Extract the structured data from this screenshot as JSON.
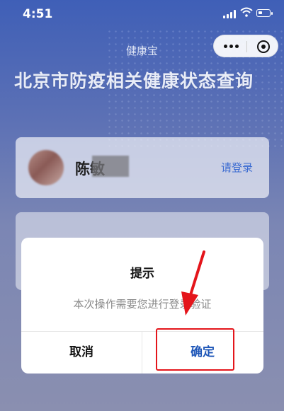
{
  "status_bar": {
    "time": "4:51"
  },
  "header": {
    "app_title": "健康宝"
  },
  "page": {
    "heading": "北京市防疫相关健康状态查询"
  },
  "user_card": {
    "name": "陈敏",
    "login_link": "请登录"
  },
  "dialog": {
    "title": "提示",
    "message": "本次操作需要您进行登录验证",
    "cancel_label": "取消",
    "confirm_label": "确定"
  },
  "colors": {
    "accent": "#1f57b8",
    "link": "#3b6bd1",
    "annotation": "#e4151b"
  }
}
